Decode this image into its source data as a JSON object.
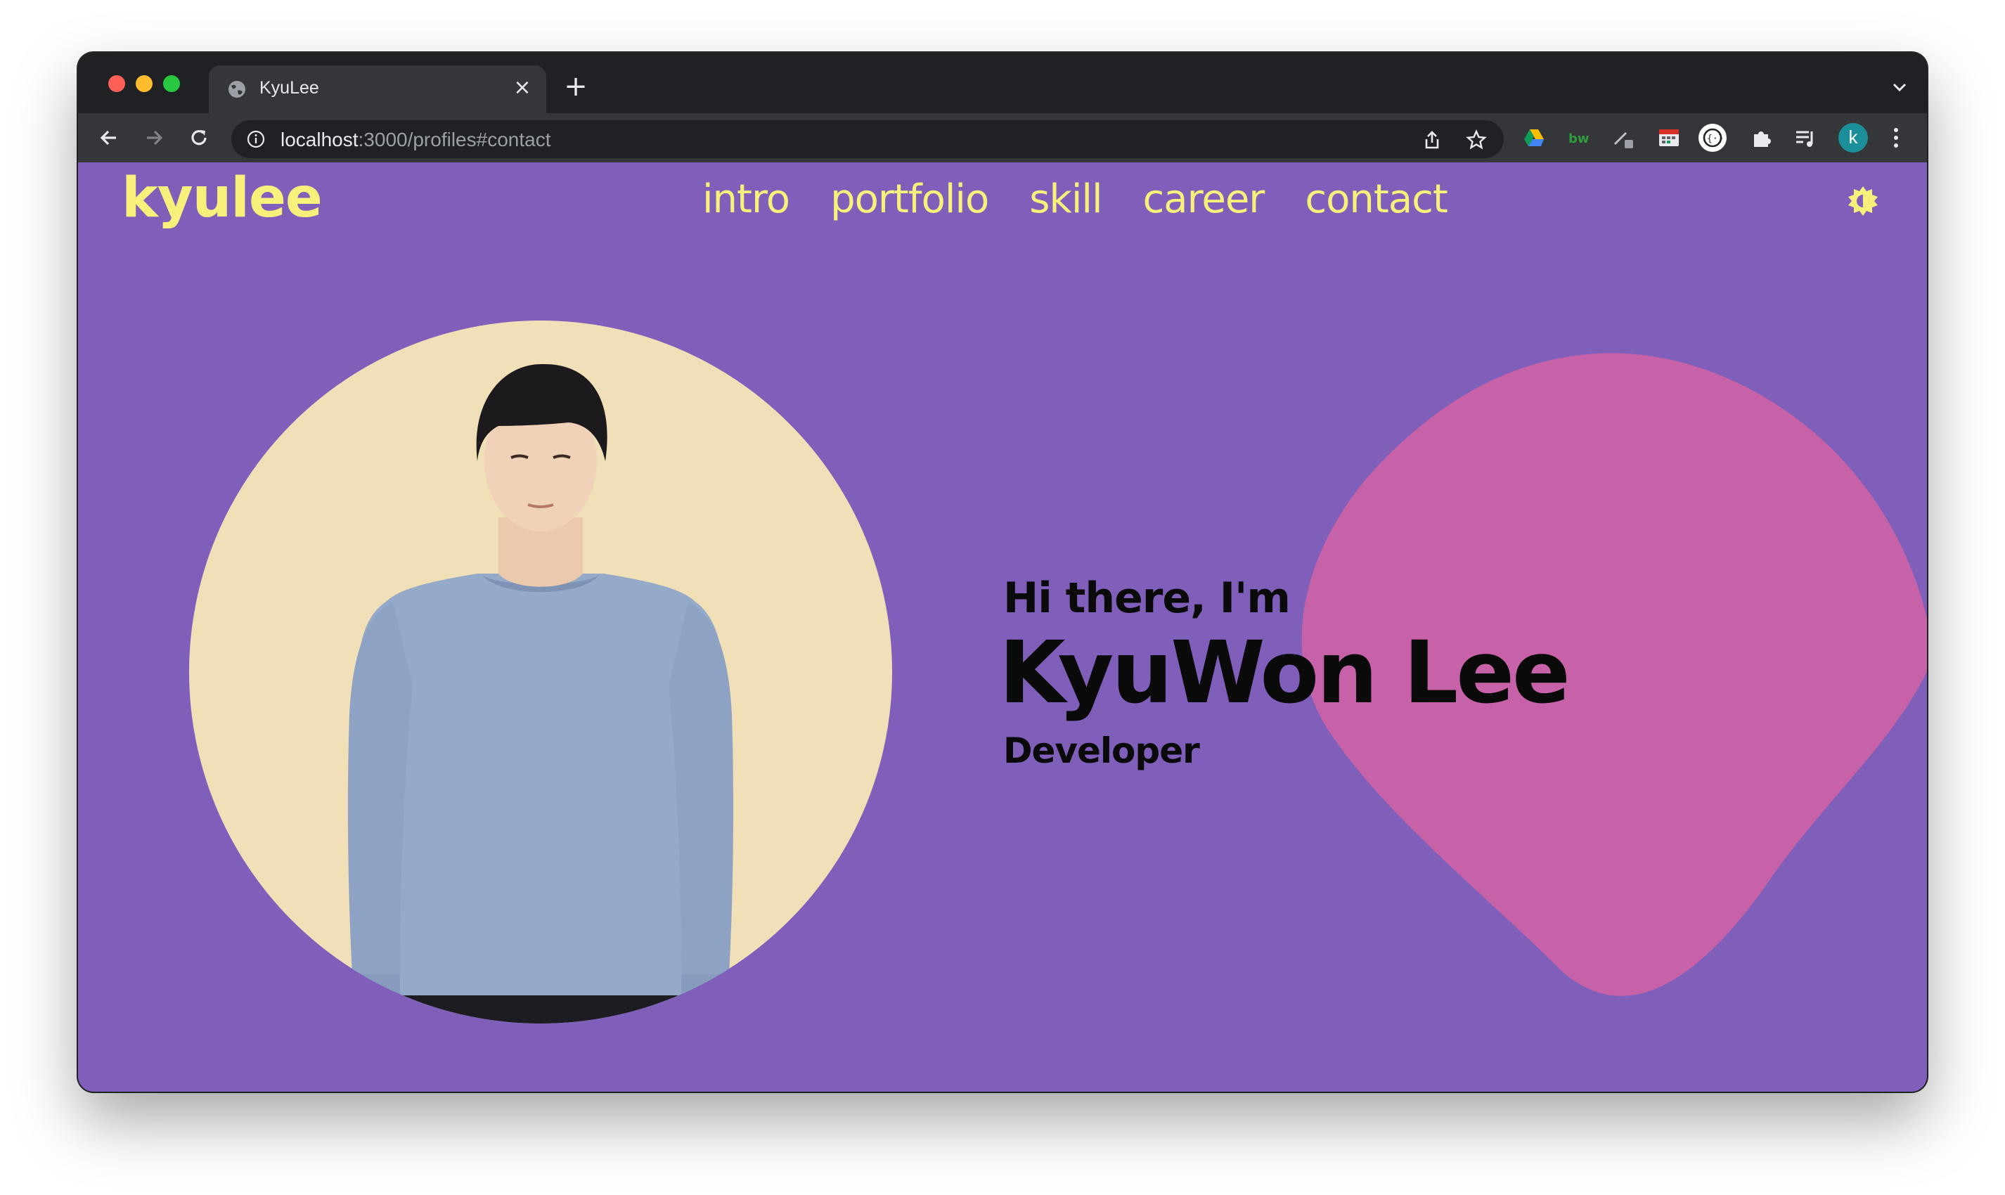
{
  "browser": {
    "tab_title": "KyuLee",
    "url_host": "localhost",
    "url_rest": ":3000/profiles#contact",
    "profile_initial": "k",
    "new_tab_label": "+",
    "close_label": "×"
  },
  "site": {
    "logo": "kyulee",
    "nav": [
      "intro",
      "portfolio",
      "skill",
      "career",
      "contact"
    ],
    "accent_color": "#f7f07a",
    "background_color": "#7f5fba",
    "blob_color": "#c762a8",
    "photo_bg_color": "#f1dfb7"
  },
  "hero": {
    "greeting": "Hi there, I'm",
    "name": "KyuWon Lee",
    "role": "Developer"
  }
}
